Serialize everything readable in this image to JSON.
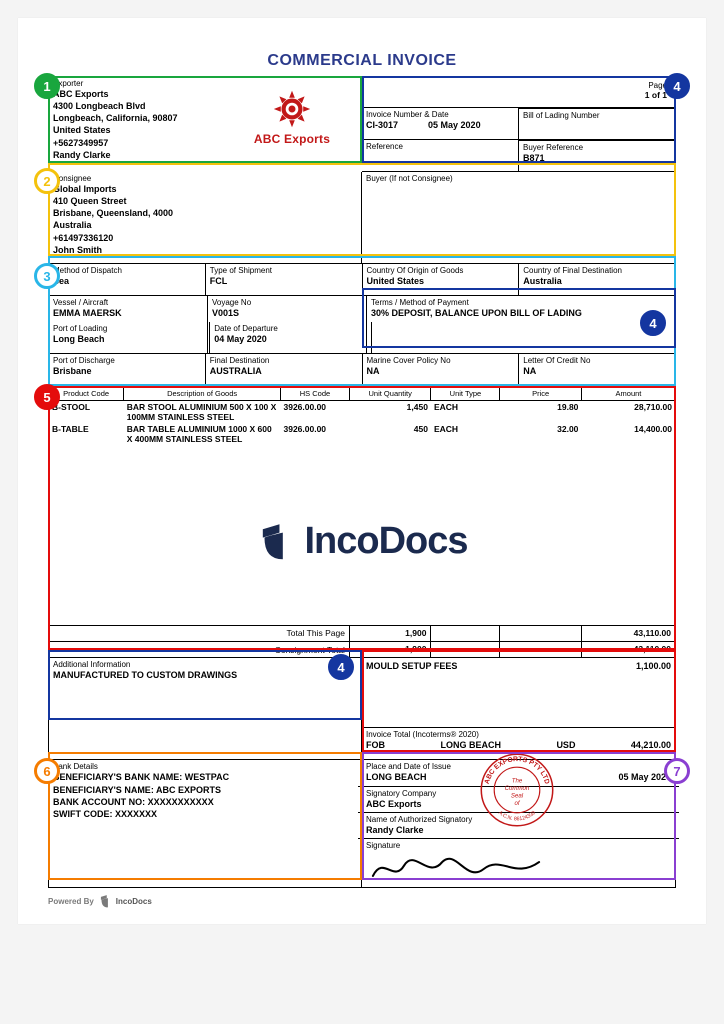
{
  "title": "COMMERCIAL INVOICE",
  "exporter": {
    "label": "Exporter",
    "name": "ABC Exports",
    "addr1": "4300 Longbeach Blvd",
    "addr2": "Longbeach, California, 90807",
    "country": "United States",
    "phone": "+5627349957",
    "contact": "Randy Clarke",
    "logo_text": "ABC Exports"
  },
  "pages": {
    "label": "Pages",
    "value": "1 of 1"
  },
  "invoice_no": {
    "label": "Invoice Number & Date",
    "id": "CI-3017",
    "date": "05 May 2020"
  },
  "bol": {
    "label": "Bill of Lading Number",
    "value": ""
  },
  "reference": {
    "label": "Reference",
    "value": ""
  },
  "buyer_ref": {
    "label": "Buyer Reference",
    "value": "B871"
  },
  "consignee": {
    "label": "Consignee",
    "name": "Global Imports",
    "addr1": "410 Queen Street",
    "addr2": "Brisbane, Queensland, 4000",
    "country": "Australia",
    "phone": "+61497336120",
    "contact": "John Smith"
  },
  "buyer_not_consignee": {
    "label": "Buyer (If not Consignee)",
    "value": ""
  },
  "dispatch": {
    "label": "Method of Dispatch",
    "value": "Sea"
  },
  "shipment_type": {
    "label": "Type of Shipment",
    "value": "FCL"
  },
  "origin": {
    "label": "Country Of Origin of Goods",
    "value": "United States"
  },
  "dest_country": {
    "label": "Country of Final Destination",
    "value": "Australia"
  },
  "vessel": {
    "label": "Vessel / Aircraft",
    "value": "EMMA MAERSK"
  },
  "voyage": {
    "label": "Voyage No",
    "value": "V001S"
  },
  "terms": {
    "label": "Terms / Method of Payment",
    "value": "30% DEPOSIT, BALANCE UPON BILL OF LADING"
  },
  "port_loading": {
    "label": "Port of Loading",
    "value": "Long Beach"
  },
  "departure": {
    "label": "Date of Departure",
    "value": "04 May 2020"
  },
  "port_discharge": {
    "label": "Port of Discharge",
    "value": "Brisbane"
  },
  "final_dest": {
    "label": "Final Destination",
    "value": "AUSTRALIA"
  },
  "marine": {
    "label": "Marine Cover Policy No",
    "value": "NA"
  },
  "letter_credit": {
    "label": "Letter Of Credit No",
    "value": "NA"
  },
  "item_headers": {
    "code": "Product Code",
    "desc": "Description of Goods",
    "hs": "HS Code",
    "qty": "Unit Quantity",
    "type": "Unit Type",
    "price": "Price",
    "amount": "Amount"
  },
  "items": [
    {
      "code": "B-STOOL",
      "desc": "BAR STOOL ALUMINIUM 500 X 100 X 100MM STAINLESS STEEL",
      "hs": "3926.00.00",
      "qty": "1,450",
      "type": "EACH",
      "price": "19.80",
      "amount": "28,710.00"
    },
    {
      "code": "B-TABLE",
      "desc": "BAR TABLE ALUMINIUM 1000 X 600 X 400MM STAINLESS STEEL",
      "hs": "3926.00.00",
      "qty": "450",
      "type": "EACH",
      "price": "32.00",
      "amount": "14,400.00"
    }
  ],
  "watermark": "IncoDocs",
  "totals": {
    "page_label": "Total This Page",
    "page_qty": "1,900",
    "page_amount": "43,110.00",
    "consign_label": "Consignment Total",
    "consign_qty": "1,900",
    "consign_amount": "43,110.00"
  },
  "additional": {
    "label": "Additional Information",
    "value": "MANUFACTURED TO CUSTOM DRAWINGS"
  },
  "extra_charge": {
    "label": "MOULD SETUP FEES",
    "amount": "1,100.00"
  },
  "invoice_total": {
    "label": "Invoice Total (Incoterms® 2020)",
    "term": "FOB",
    "place": "LONG BEACH",
    "currency": "USD",
    "amount": "44,210.00"
  },
  "bank": {
    "label": "Bank Details",
    "line1": "BENEFICIARY'S BANK NAME:  WESTPAC",
    "line2": "BENEFICIARY'S NAME:  ABC EXPORTS",
    "line3": "BANK ACCOUNT NO:  XXXXXXXXXXX",
    "line4": "SWIFT CODE:  XXXXXXX"
  },
  "issue": {
    "place_label": "Place and Date of Issue",
    "place": "LONG BEACH",
    "date": "05 May 2020",
    "company_label": "Signatory Company",
    "company": "ABC Exports",
    "name_label": "Name of Authorized Signatory",
    "name": "Randy Clarke",
    "sig_label": "Signature"
  },
  "seal": {
    "outer": "ABC EXPORTS PTY LTD",
    "acn": "A.C.N. 86124339",
    "inner1": "The",
    "inner2": "Common",
    "inner3": "Seal",
    "inner4": "of"
  },
  "footer": {
    "powered": "Powered By",
    "brand": "IncoDocs"
  },
  "badges": [
    "1",
    "2",
    "3",
    "4",
    "5",
    "6",
    "7"
  ]
}
